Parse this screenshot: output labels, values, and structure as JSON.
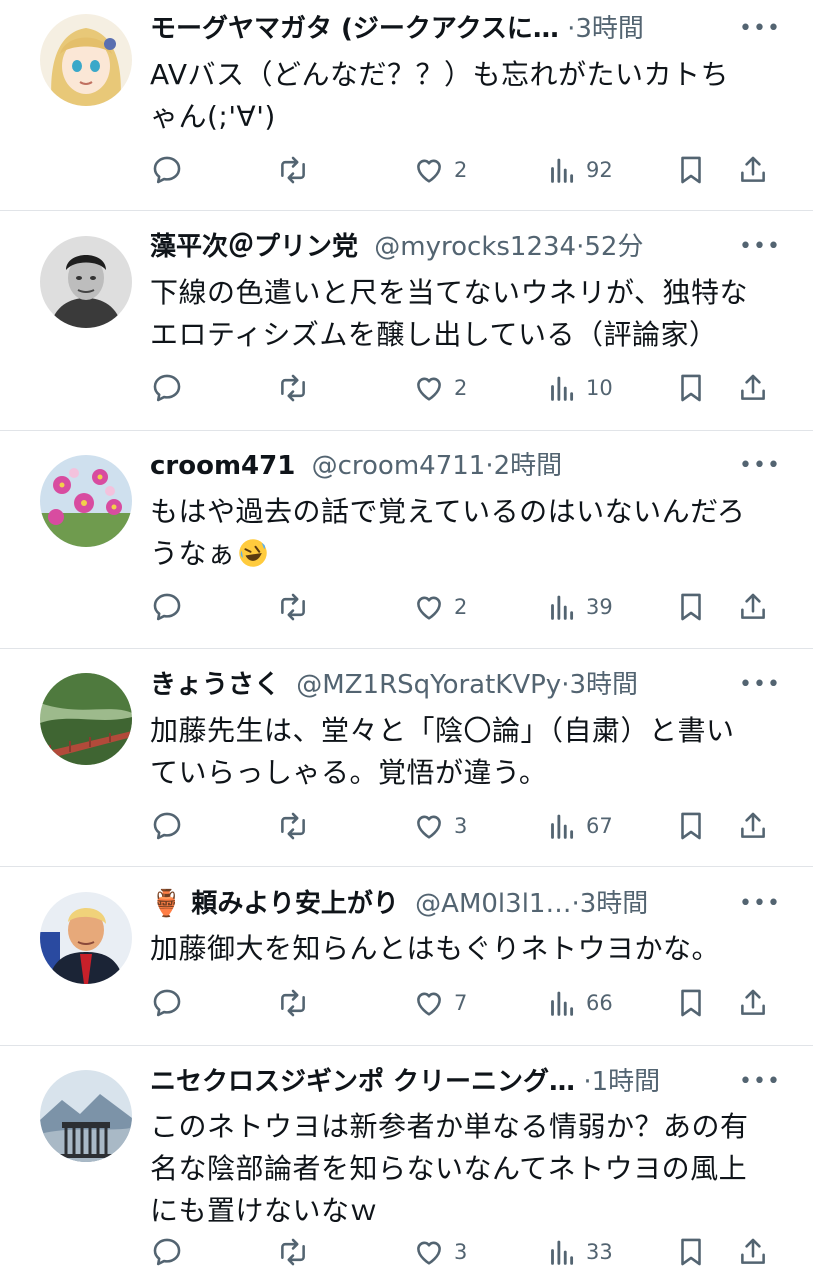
{
  "posts": [
    {
      "name": "モーグヤマガタ (ジークアクスに…",
      "handle": "",
      "separator": "·",
      "time": "3時間",
      "text": "AVバス（どんなだ？？）も忘れがたいカトち\nゃん(;'∀')",
      "replies": "",
      "reposts": "",
      "likes": "2",
      "views": "92"
    },
    {
      "name": "藻平次＠プリン党",
      "handle": "@myrocks1234",
      "separator": "·",
      "time": "52分",
      "text": "下線の色遣いと尺を当てないウネリが、独特な\nエロティシズムを醸し出している（評論家）",
      "replies": "",
      "reposts": "",
      "likes": "2",
      "views": "10"
    },
    {
      "name": "croom471",
      "handle": "@croom4711",
      "separator": "·",
      "time": "2時間",
      "text": "もはや過去の話で覚えているのはいないんだろ\nうなぁ",
      "emoji": "rolling-on-floor-laughing-emoji",
      "replies": "",
      "reposts": "",
      "likes": "2",
      "views": "39"
    },
    {
      "name": "きょうさく",
      "handle": "@MZ1RSqYoratKVPy",
      "separator": "·",
      "time": "3時間",
      "text": "加藤先生は、堂々と「陰〇論」（自粛）と書い\nていらっしゃる。覚悟が違う。",
      "replies": "",
      "reposts": "",
      "likes": "3",
      "views": "67"
    },
    {
      "name": "🏺 頼みより安上がり",
      "handle": "@AM0l3l1…",
      "separator": "·",
      "time": "3時間",
      "text": "加藤御大を知らんとはもぐりネトウヨかな。",
      "replies": "",
      "reposts": "",
      "likes": "7",
      "views": "66"
    },
    {
      "name": "ニセクロスジギンポ クリーニング…",
      "handle": "",
      "separator": "·",
      "time": "1時間",
      "text": "このネトウヨは新参者か単なる情弱か？あの有\n名な陰部論者を知らないなんてネトウヨの風上\nにも置けないなｗ",
      "replies": "",
      "reposts": "",
      "likes": "3",
      "views": "33"
    }
  ],
  "icons": {
    "reply": "reply-icon",
    "repost": "repost-icon",
    "like": "heart-icon",
    "views": "views-icon",
    "bookmark": "bookmark-icon",
    "share": "share-icon",
    "more": "more-icon"
  },
  "colors": {
    "text": "#0f1419",
    "secondary": "#536471",
    "divider": "#e1e4e8"
  }
}
